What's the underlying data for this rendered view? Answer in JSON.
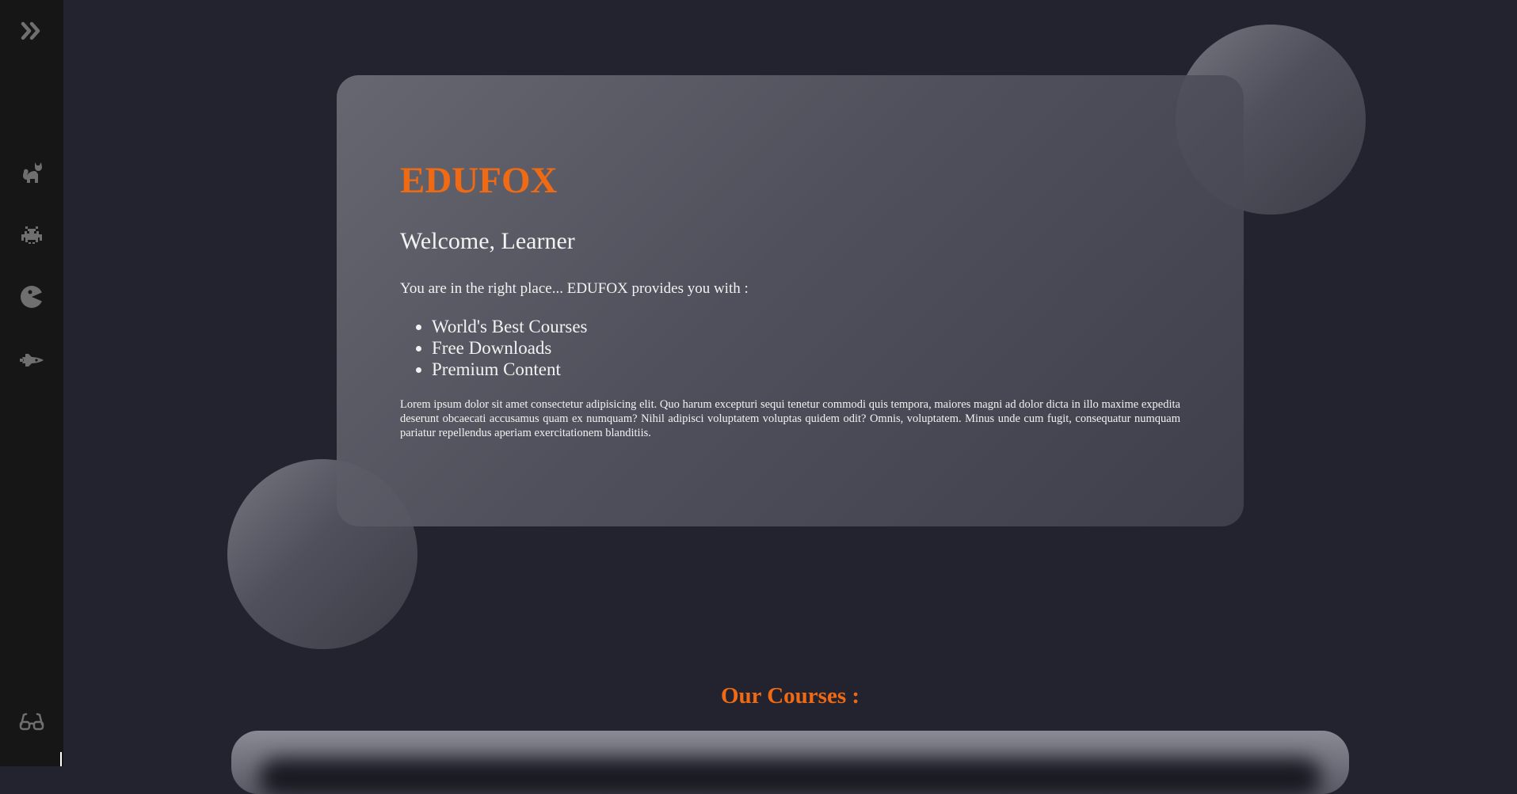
{
  "sidebar": {
    "items": [
      {
        "icon": "double-chevron-right-icon"
      },
      {
        "icon": "cat-icon"
      },
      {
        "icon": "space-invader-icon"
      },
      {
        "icon": "pacman-ghost-icon"
      },
      {
        "icon": "space-shuttle-icon"
      },
      {
        "icon": "glasses-icon"
      }
    ],
    "icon_color": "#6f6f6f"
  },
  "hero": {
    "brand": "EDUFOX",
    "welcome": "Welcome, Learner",
    "intro": "You are in the right place... EDUFOX provides you with :",
    "features": [
      "World's Best Courses",
      "Free Downloads",
      "Premium Content"
    ],
    "lorem": "Lorem ipsum dolor sit amet consectetur adipisicing elit. Quo harum excepturi sequi tenetur commodi quis tempora, maiores magni ad dolor dicta in illo maxime expedita deserunt obcaecati accusamus quam ex numquam? Nihil adipisci voluptatem voluptas quidem odit? Omnis, voluptatem. Minus unde cum fugit, consequatur numquam pariatur repellendus aperiam exercitationem blanditiis."
  },
  "courses": {
    "title": "Our Courses :"
  },
  "colors": {
    "accent": "#f06a13",
    "background": "#23232f",
    "sidebar": "#161616"
  }
}
